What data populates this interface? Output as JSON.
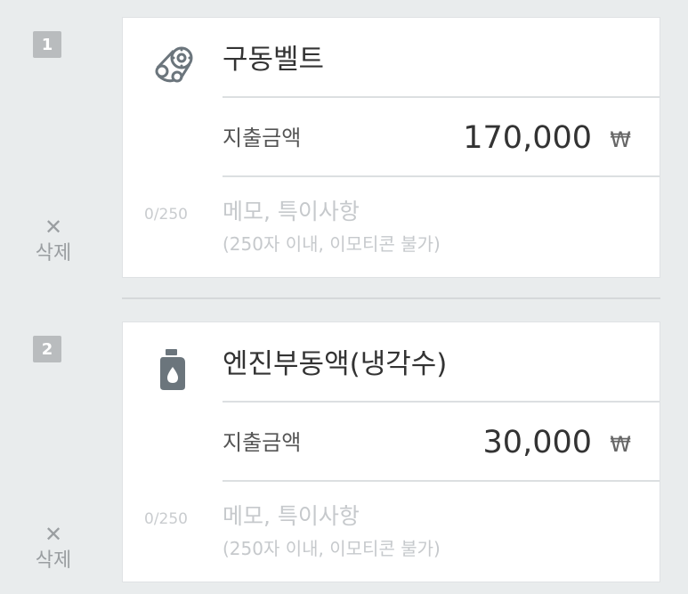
{
  "entries": [
    {
      "number": "1",
      "title": "구동벨트",
      "icon": "belt-pulley-icon",
      "amount_label": "지출금액",
      "amount": "170,000",
      "currency": "₩",
      "memo_count": "0/250",
      "memo_placeholder": "메모, 특이사항",
      "memo_hint": "(250자 이내, 이모티콘 불가)",
      "delete_label": "삭제"
    },
    {
      "number": "2",
      "title": "엔진부동액(냉각수)",
      "icon": "coolant-bottle-icon",
      "amount_label": "지출금액",
      "amount": "30,000",
      "currency": "₩",
      "memo_count": "0/250",
      "memo_placeholder": "메모, 특이사항",
      "memo_hint": "(250자 이내, 이모티콘 불가)",
      "delete_label": "삭제"
    }
  ],
  "colors": {
    "background": "#e9eced",
    "badge": "#b9bcbe",
    "icon": "#6b757c"
  }
}
